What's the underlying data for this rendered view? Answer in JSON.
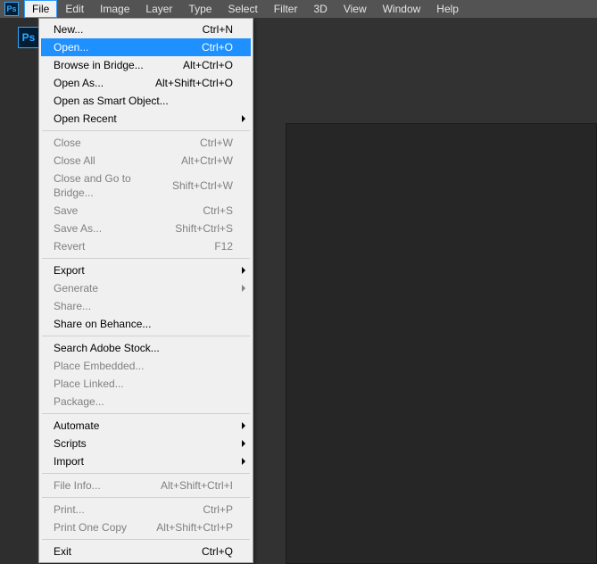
{
  "app_icon_text": "Ps",
  "logo_badge_text": "Ps",
  "menubar": {
    "items": [
      {
        "label": "File",
        "active": true
      },
      {
        "label": "Edit"
      },
      {
        "label": "Image"
      },
      {
        "label": "Layer"
      },
      {
        "label": "Type"
      },
      {
        "label": "Select"
      },
      {
        "label": "Filter"
      },
      {
        "label": "3D"
      },
      {
        "label": "View"
      },
      {
        "label": "Window"
      },
      {
        "label": "Help"
      }
    ]
  },
  "dropdown": {
    "groups": [
      [
        {
          "label": "New...",
          "shortcut": "Ctrl+N"
        },
        {
          "label": "Open...",
          "shortcut": "Ctrl+O",
          "highlight": true
        },
        {
          "label": "Browse in Bridge...",
          "shortcut": "Alt+Ctrl+O"
        },
        {
          "label": "Open As...",
          "shortcut": "Alt+Shift+Ctrl+O"
        },
        {
          "label": "Open as Smart Object..."
        },
        {
          "label": "Open Recent",
          "submenu": true
        }
      ],
      [
        {
          "label": "Close",
          "shortcut": "Ctrl+W",
          "disabled": true
        },
        {
          "label": "Close All",
          "shortcut": "Alt+Ctrl+W",
          "disabled": true
        },
        {
          "label": "Close and Go to Bridge...",
          "shortcut": "Shift+Ctrl+W",
          "disabled": true
        },
        {
          "label": "Save",
          "shortcut": "Ctrl+S",
          "disabled": true
        },
        {
          "label": "Save As...",
          "shortcut": "Shift+Ctrl+S",
          "disabled": true
        },
        {
          "label": "Revert",
          "shortcut": "F12",
          "disabled": true
        }
      ],
      [
        {
          "label": "Export",
          "submenu": true
        },
        {
          "label": "Generate",
          "submenu": true,
          "disabled": true
        },
        {
          "label": "Share...",
          "disabled": true
        },
        {
          "label": "Share on Behance..."
        }
      ],
      [
        {
          "label": "Search Adobe Stock..."
        },
        {
          "label": "Place Embedded...",
          "disabled": true
        },
        {
          "label": "Place Linked...",
          "disabled": true
        },
        {
          "label": "Package...",
          "disabled": true
        }
      ],
      [
        {
          "label": "Automate",
          "submenu": true
        },
        {
          "label": "Scripts",
          "submenu": true
        },
        {
          "label": "Import",
          "submenu": true
        }
      ],
      [
        {
          "label": "File Info...",
          "shortcut": "Alt+Shift+Ctrl+I",
          "disabled": true
        }
      ],
      [
        {
          "label": "Print...",
          "shortcut": "Ctrl+P",
          "disabled": true
        },
        {
          "label": "Print One Copy",
          "shortcut": "Alt+Shift+Ctrl+P",
          "disabled": true
        }
      ],
      [
        {
          "label": "Exit",
          "shortcut": "Ctrl+Q"
        }
      ]
    ]
  }
}
